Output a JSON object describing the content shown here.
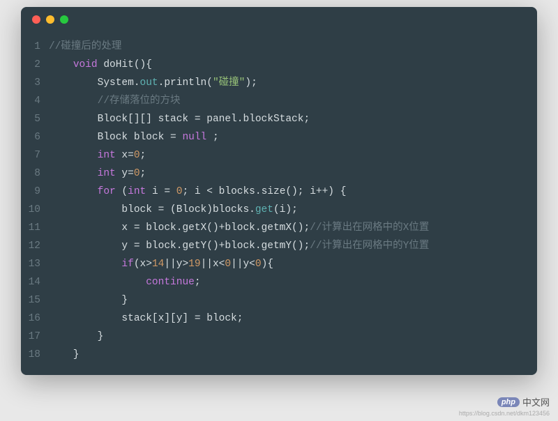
{
  "window": {
    "traffic_lights": [
      "close",
      "minimize",
      "maximize"
    ]
  },
  "code": {
    "lines": [
      {
        "n": 1,
        "tokens": [
          {
            "t": "//碰撞后的处理",
            "c": "comment"
          }
        ]
      },
      {
        "n": 2,
        "tokens": [
          {
            "t": "    ",
            "c": "ident"
          },
          {
            "t": "void",
            "c": "keyword"
          },
          {
            "t": " doHit(){",
            "c": "ident"
          }
        ]
      },
      {
        "n": 3,
        "tokens": [
          {
            "t": "        System.",
            "c": "ident"
          },
          {
            "t": "out",
            "c": "method"
          },
          {
            "t": ".println(",
            "c": "ident"
          },
          {
            "t": "\"碰撞\"",
            "c": "string"
          },
          {
            "t": ");",
            "c": "ident"
          }
        ]
      },
      {
        "n": 4,
        "tokens": [
          {
            "t": "        ",
            "c": "ident"
          },
          {
            "t": "//存储落位的方块",
            "c": "comment"
          }
        ]
      },
      {
        "n": 5,
        "tokens": [
          {
            "t": "        Block[][] stack = panel.blockStack;",
            "c": "ident"
          }
        ]
      },
      {
        "n": 6,
        "tokens": [
          {
            "t": "        Block block = ",
            "c": "ident"
          },
          {
            "t": "null",
            "c": "keyword"
          },
          {
            "t": " ;",
            "c": "ident"
          }
        ]
      },
      {
        "n": 7,
        "tokens": [
          {
            "t": "        ",
            "c": "ident"
          },
          {
            "t": "int",
            "c": "keyword"
          },
          {
            "t": " x=",
            "c": "ident"
          },
          {
            "t": "0",
            "c": "number"
          },
          {
            "t": ";",
            "c": "ident"
          }
        ]
      },
      {
        "n": 8,
        "tokens": [
          {
            "t": "        ",
            "c": "ident"
          },
          {
            "t": "int",
            "c": "keyword"
          },
          {
            "t": " y=",
            "c": "ident"
          },
          {
            "t": "0",
            "c": "number"
          },
          {
            "t": ";",
            "c": "ident"
          }
        ]
      },
      {
        "n": 9,
        "tokens": [
          {
            "t": "        ",
            "c": "ident"
          },
          {
            "t": "for",
            "c": "keyword"
          },
          {
            "t": " (",
            "c": "ident"
          },
          {
            "t": "int",
            "c": "keyword"
          },
          {
            "t": " i = ",
            "c": "ident"
          },
          {
            "t": "0",
            "c": "number"
          },
          {
            "t": "; i < blocks.size(); i++) {",
            "c": "ident"
          }
        ]
      },
      {
        "n": 10,
        "tokens": [
          {
            "t": "            block = (Block)blocks.",
            "c": "ident"
          },
          {
            "t": "get",
            "c": "method"
          },
          {
            "t": "(i);",
            "c": "ident"
          }
        ]
      },
      {
        "n": 11,
        "tokens": [
          {
            "t": "            x = block.getX()+block.getmX();",
            "c": "ident"
          },
          {
            "t": "//计算出在网格中的X位置",
            "c": "comment"
          }
        ]
      },
      {
        "n": 12,
        "tokens": [
          {
            "t": "            y = block.getY()+block.getmY();",
            "c": "ident"
          },
          {
            "t": "//计算出在网格中的Y位置",
            "c": "comment"
          }
        ]
      },
      {
        "n": 13,
        "tokens": [
          {
            "t": "            ",
            "c": "ident"
          },
          {
            "t": "if",
            "c": "keyword"
          },
          {
            "t": "(x>",
            "c": "ident"
          },
          {
            "t": "14",
            "c": "number"
          },
          {
            "t": "||y>",
            "c": "ident"
          },
          {
            "t": "19",
            "c": "number"
          },
          {
            "t": "||x<",
            "c": "ident"
          },
          {
            "t": "0",
            "c": "number"
          },
          {
            "t": "||y<",
            "c": "ident"
          },
          {
            "t": "0",
            "c": "number"
          },
          {
            "t": "){",
            "c": "ident"
          }
        ]
      },
      {
        "n": 14,
        "tokens": [
          {
            "t": "                ",
            "c": "ident"
          },
          {
            "t": "continue",
            "c": "keyword"
          },
          {
            "t": ";",
            "c": "ident"
          }
        ]
      },
      {
        "n": 15,
        "tokens": [
          {
            "t": "            }",
            "c": "ident"
          }
        ]
      },
      {
        "n": 16,
        "tokens": [
          {
            "t": "            stack[x][y] = block;",
            "c": "ident"
          }
        ]
      },
      {
        "n": 17,
        "tokens": [
          {
            "t": "        }",
            "c": "ident"
          }
        ]
      },
      {
        "n": 18,
        "tokens": [
          {
            "t": "    }",
            "c": "ident"
          }
        ]
      }
    ]
  },
  "watermark": {
    "logo_badge": "php",
    "logo_text": "中文网",
    "url": "https://blog.csdn.net/dkm123456"
  }
}
